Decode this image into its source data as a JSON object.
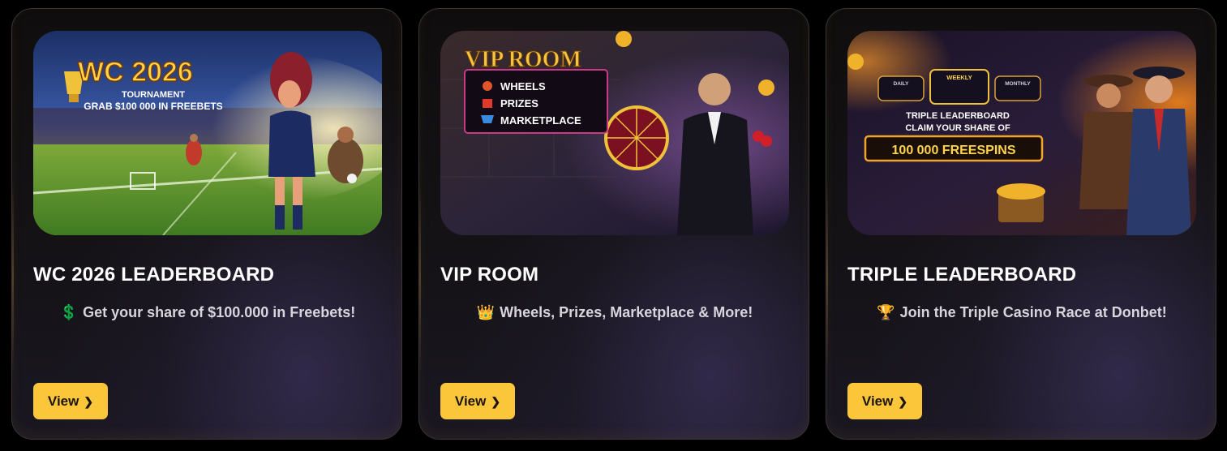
{
  "cards": [
    {
      "title": "WC 2026 LEADERBOARD",
      "emoji": "💲",
      "description": "Get your share of $100.000 in Freebets!",
      "button_label": "View",
      "banner": {
        "headline": "WC 2026",
        "line1": "TOURNAMENT",
        "line2": "GRAB $100 000 IN FREEBETS"
      }
    },
    {
      "title": "VIP ROOM",
      "emoji": "👑",
      "description": "Wheels, Prizes, Marketplace & More!",
      "button_label": "View",
      "banner": {
        "headline": "VIP ROOM",
        "items": [
          "WHEELS",
          "PRIZES",
          "MARKETPLACE"
        ]
      }
    },
    {
      "title": "TRIPLE LEADERBOARD",
      "emoji": "🏆",
      "description": "Join the Triple Casino Race at Donbet!",
      "button_label": "View",
      "banner": {
        "tabs": [
          "DAILY",
          "WEEKLY",
          "MONTHLY"
        ],
        "line1": "TRIPLE LEADERBOARD",
        "line2": "CLAIM YOUR SHARE OF",
        "highlight": "100 000 FREESPINS"
      }
    }
  ],
  "icons": {
    "chevron": "chevron-right-icon"
  },
  "colors": {
    "button": "#fcc63a",
    "title": "#ffffff",
    "description": "#d8d6dc",
    "gold": "#f5b92e"
  }
}
